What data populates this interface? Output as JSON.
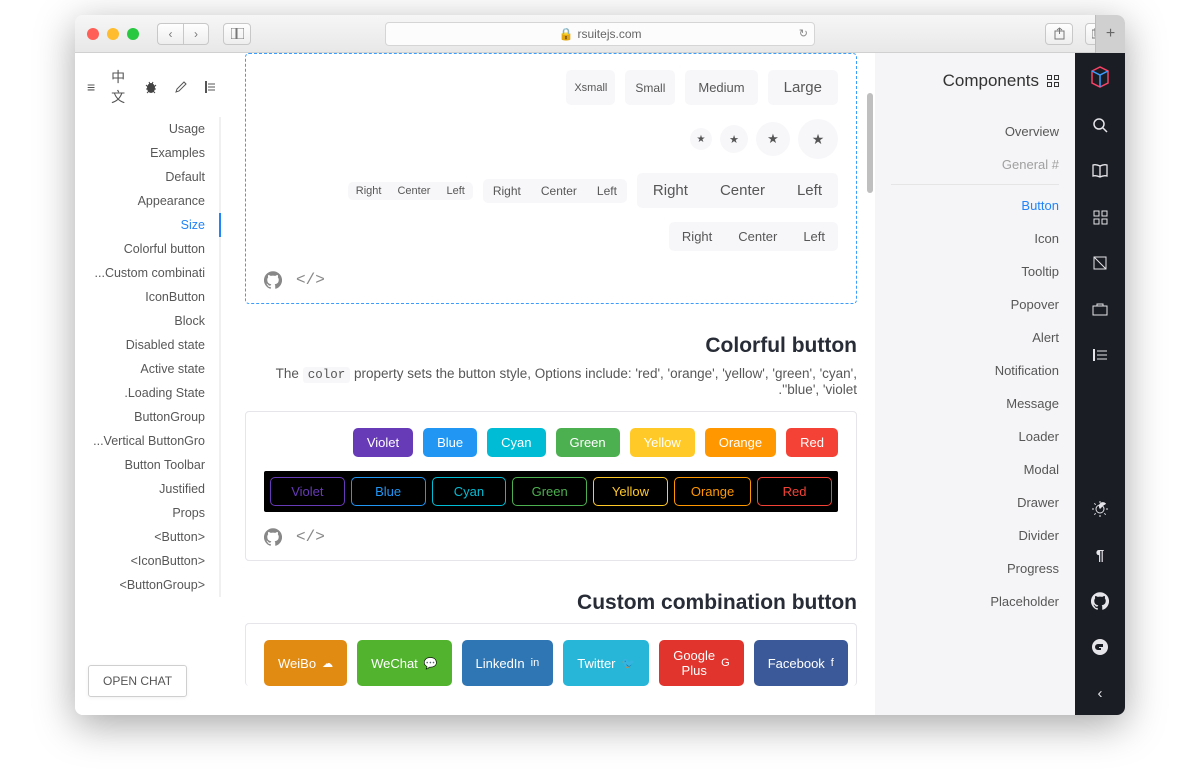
{
  "browser": {
    "url": "rsuitejs.com",
    "nav_back": "‹",
    "nav_forward": "›"
  },
  "left_toolbar": {
    "menu": "≡",
    "lang": "中文",
    "bug": "🐞",
    "edit": "✎",
    "flag": "⚑"
  },
  "local_nav": {
    "items": [
      {
        "label": "Usage"
      },
      {
        "label": "Examples"
      },
      {
        "label": "Default"
      },
      {
        "label": "Appearance"
      },
      {
        "label": "Size",
        "active": true
      },
      {
        "label": "Colorful button"
      },
      {
        "label": "...Custom combinati"
      },
      {
        "label": "IconButton"
      },
      {
        "label": "Block"
      },
      {
        "label": "Disabled state"
      },
      {
        "label": "Active state"
      },
      {
        "label": ".Loading State"
      },
      {
        "label": "ButtonGroup"
      },
      {
        "label": "...Vertical ButtonGro"
      },
      {
        "label": "Button Toolbar"
      },
      {
        "label": "Justified"
      },
      {
        "label": "Props"
      },
      {
        "label": "<Button>"
      },
      {
        "label": "<IconButton>"
      },
      {
        "label": "<ButtonGroup>"
      }
    ]
  },
  "open_chat": "OPEN CHAT",
  "size_demo": {
    "sizes": {
      "xs": "Xsmall",
      "sm": "Small",
      "md": "Medium",
      "lg": "Large"
    },
    "group_labels": {
      "r": "Right",
      "c": "Center",
      "l": "Left"
    }
  },
  "colorful": {
    "title": "Colorful button",
    "desc_pre": "The ",
    "desc_code": "color",
    "desc_post": " property sets the button style, Options include: 'red', 'orange', 'yellow', 'green', 'cyan', .''blue', 'violet",
    "buttons": [
      {
        "label": "Violet",
        "bg": "#673ab7"
      },
      {
        "label": "Blue",
        "bg": "#2196f3"
      },
      {
        "label": "Cyan",
        "bg": "#00bcd4"
      },
      {
        "label": "Green",
        "bg": "#4caf50"
      },
      {
        "label": "Yellow",
        "bg": "#ffca28"
      },
      {
        "label": "Orange",
        "bg": "#ff9800"
      },
      {
        "label": "Red",
        "bg": "#f44336"
      }
    ]
  },
  "custom": {
    "title": "Custom combination button",
    "buttons": [
      {
        "label": "WeiBo",
        "bg": "#e28b13",
        "icon": "☁"
      },
      {
        "label": "WeChat",
        "bg": "#51b32e",
        "icon": "💬"
      },
      {
        "label": "LinkedIn",
        "bg": "#2e76b4",
        "icon": "in"
      },
      {
        "label": "Twitter",
        "bg": "#28b6d8",
        "icon": "🐦"
      },
      {
        "label": "Google Plus",
        "bg": "#e0342c",
        "icon": "G"
      },
      {
        "label": "Facebook",
        "bg": "#3b5998",
        "icon": "f"
      }
    ]
  },
  "components_panel": {
    "title": "Components",
    "items": [
      {
        "label": "Overview"
      },
      {
        "label": "General #",
        "section": true
      },
      {
        "label": "Button",
        "active": true
      },
      {
        "label": "Icon"
      },
      {
        "label": "Tooltip"
      },
      {
        "label": "Popover"
      },
      {
        "label": "Alert"
      },
      {
        "label": "Notification"
      },
      {
        "label": "Message"
      },
      {
        "label": "Loader"
      },
      {
        "label": "Modal"
      },
      {
        "label": "Drawer"
      },
      {
        "label": "Divider"
      },
      {
        "label": "Progress"
      },
      {
        "label": "Placeholder"
      }
    ]
  },
  "rail": {
    "search": "search-icon",
    "book": "book-icon",
    "grid": "grid-icon",
    "palette": "palette-icon",
    "toolbox": "toolbox-icon",
    "rtl": "rtl-icon",
    "brightness": "brightness-icon",
    "pilcrow": "pilcrow-icon",
    "github": "github-icon",
    "gitee": "gitee-icon",
    "collapse": "collapse-icon"
  }
}
